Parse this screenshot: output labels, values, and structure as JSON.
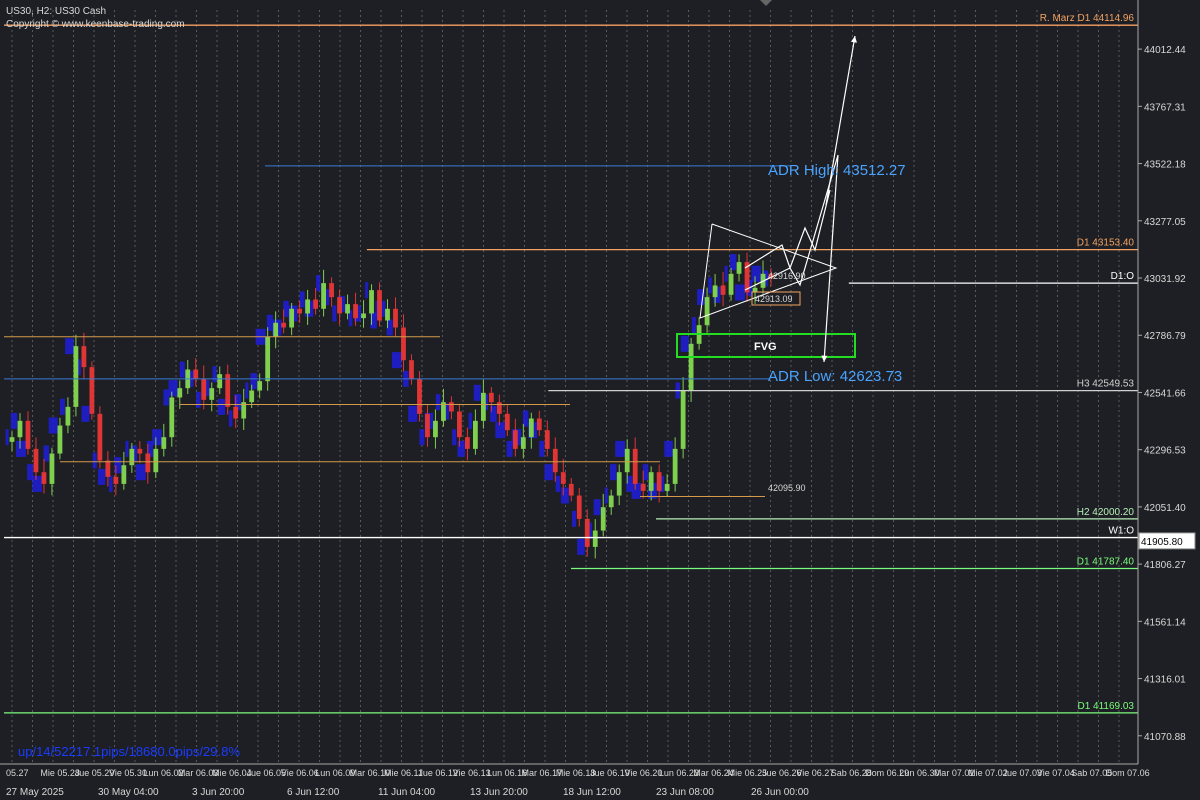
{
  "header": {
    "symbol_line": "US30, H2:  US30 Cash",
    "copyright": "Copyright © www.keenbase-trading.com"
  },
  "stats_text": "up/14/52217.1pips/18680.0pips/29.8%",
  "price_axis": {
    "labels": [
      "44012.44",
      "43767.31",
      "43522.18",
      "43277.05",
      "43031.92",
      "42786.79",
      "42541.66",
      "42296.53",
      "42051.40",
      "41806.27",
      "41561.14",
      "41316.01",
      "41070.88"
    ],
    "current_price": "41905.80"
  },
  "time_axis": {
    "upper": [
      "05.27",
      "Mie 05.28",
      "Jue 05.29",
      "Vie 05.30",
      "Lun 06.02",
      "Mar 06.03",
      "Mie 06.04",
      "Jue 06.05",
      "Vie 06.06",
      "Lun 06.09",
      "Mar 06.10",
      "Mie 06.11",
      "Jue 06.12",
      "Vie 06.13",
      "Lun 06.16",
      "Mar 06.17",
      "Mie 06.18",
      "Jue 06.19",
      "Vie 06.20",
      "Lun 06.23",
      "Mar 06.24",
      "Mie 06.25",
      "Jue 06.26",
      "Vie 06.27",
      "Sab 06.28",
      "Dom 06.29",
      "Lun 06.30",
      "Mar 07.01",
      "Mie 07.02",
      "Jue 07.03",
      "Vie 07.04",
      "Sab 07.05",
      "Dom 07.06"
    ],
    "lower": [
      "27 May 2025",
      "30 May 04:00",
      "3 Jun 20:00",
      "6 Jun 12:00",
      "11 Jun 04:00",
      "13 Jun 20:00",
      "18 Jun 12:00",
      "23 Jun 08:00",
      "26 Jun 00:00"
    ]
  },
  "levels": [
    {
      "label": "R. Marz D1 44114.96",
      "price": 44114.96,
      "color": "#f4a261",
      "x_start_frac": 0.0
    },
    {
      "label": "D1 43153.40",
      "price": 43153.4,
      "color": "#f4a261",
      "x_start_frac": 0.32
    },
    {
      "label": "D1:O",
      "price": 43010.0,
      "color": "#ffffff",
      "x_start_frac": 0.745
    },
    {
      "label": "H3 42549.53",
      "price": 42549.53,
      "color": "#d0d0d0",
      "x_start_frac": 0.48
    },
    {
      "label": "H2 42000.20",
      "price": 42000.2,
      "color": "#b8f0b8",
      "x_start_frac": 0.575
    },
    {
      "label": "W1:O",
      "price": 41920.0,
      "color": "#ffffff",
      "x_start_frac": 0.0
    },
    {
      "label": "D1 41787.40",
      "price": 41787.4,
      "color": "#7cfc7c",
      "x_start_frac": 0.5
    },
    {
      "label": "D1 41169.03",
      "price": 41169.03,
      "color": "#7cfc7c",
      "x_start_frac": 0.0
    }
  ],
  "annotations": {
    "adr_high": "ADR High: 43512.27",
    "adr_low": "ADR Low: 42623.73",
    "fvg": "FVG",
    "level_42916": "42916.90",
    "level_42913": "42913.09",
    "level_42095": "42095.90"
  },
  "colors": {
    "background": "#1d1f24",
    "grid": "#5a5a5a",
    "bull": "#7fd04f",
    "bear": "#e03535",
    "profile": "#1f1fdc",
    "adr": "#4aa3ff",
    "fvg": "#22dd22"
  },
  "chart_data": {
    "type": "candlestick",
    "title": "US30, H2: US30 Cash",
    "ylim": [
      40950,
      44180
    ],
    "price_ticks": [
      44012.44,
      43767.31,
      43522.18,
      43277.05,
      43031.92,
      42786.79,
      42541.66,
      42296.53,
      42051.4,
      41806.27,
      41561.14,
      41316.01,
      41070.88
    ],
    "path_close": [
      42350,
      42420,
      42300,
      42200,
      42150,
      42280,
      42400,
      42480,
      42740,
      42650,
      42450,
      42250,
      42180,
      42150,
      42230,
      42300,
      42280,
      42200,
      42300,
      42350,
      42520,
      42560,
      42640,
      42600,
      42510,
      42560,
      42620,
      42480,
      42430,
      42500,
      42550,
      42590,
      42780,
      42840,
      42820,
      42900,
      42880,
      42940,
      42900,
      43010,
      42950,
      42880,
      42920,
      42860,
      42880,
      42980,
      42850,
      42900,
      42820,
      42680,
      42600,
      42450,
      42350,
      42420,
      42500,
      42460,
      42350,
      42300,
      42420,
      42540,
      42500,
      42450,
      42380,
      42300,
      42350,
      42430,
      42380,
      42300,
      42200,
      42150,
      42100,
      42000,
      41880,
      41950,
      42050,
      42100,
      42200,
      42300,
      42150,
      42120,
      42200,
      42120,
      42150,
      42300,
      42550,
      42750,
      42830,
      42950,
      43000,
      42960,
      43050,
      43100,
      42970,
      42990,
      43050,
      43030
    ]
  }
}
